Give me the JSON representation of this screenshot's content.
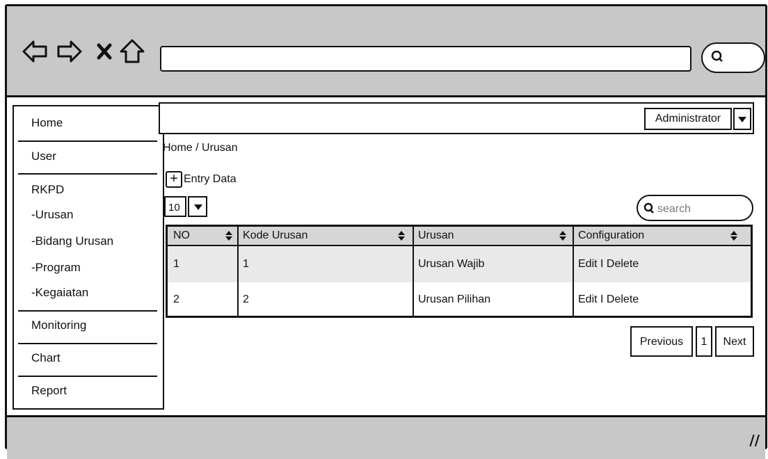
{
  "sidebar": {
    "items": [
      {
        "label": "Home"
      },
      {
        "label": "User"
      },
      {
        "label": "RKPD"
      },
      {
        "label": "-Urusan"
      },
      {
        "label": "-Bidang Urusan"
      },
      {
        "label": "-Program"
      },
      {
        "label": "-Kegaiatan"
      },
      {
        "label": "Monitoring"
      },
      {
        "label": "Chart"
      },
      {
        "label": "Report"
      }
    ]
  },
  "header": {
    "user_label": "Administrator"
  },
  "breadcrumb": "Home / Urusan",
  "entry_label": "Entry Data",
  "per_page": "10",
  "search_placeholder": "search",
  "table": {
    "columns": [
      "NO",
      "Kode Urusan",
      "Urusan",
      "Configuration"
    ],
    "rows": [
      {
        "no": "1",
        "kode": "1",
        "urusan": "Urusan Wajib",
        "config": "Edit I Delete"
      },
      {
        "no": "2",
        "kode": "2",
        "urusan": "Urusan Pilihan",
        "config": "Edit I Delete"
      }
    ]
  },
  "pagination": {
    "previous": "Previous",
    "page": "1",
    "next": "Next"
  },
  "colors": {
    "chrome": "#c8c8c8",
    "header_row": "#d6d6d6",
    "stripe_row": "#e9e9e9"
  }
}
